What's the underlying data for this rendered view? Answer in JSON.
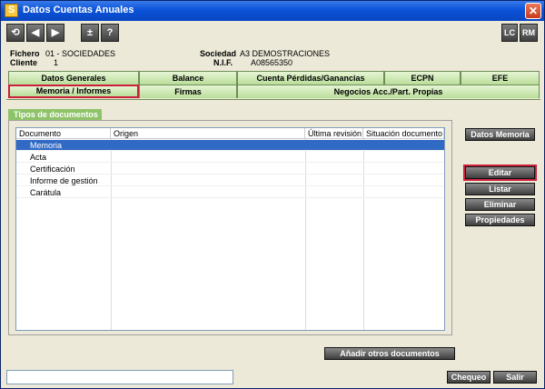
{
  "window": {
    "title": "Datos Cuentas Anuales",
    "app_icon": "S"
  },
  "toolbar": {
    "plus_minus": "±",
    "help": "?",
    "lc": "LC",
    "rm": "RM"
  },
  "info": {
    "fichero_label": "Fichero",
    "fichero_value": "01 - SOCIEDADES",
    "cliente_label": "Cliente",
    "cliente_value": "1",
    "sociedad_label": "Sociedad",
    "sociedad_value": "A3 DEMOSTRACIONES",
    "nif_label": "N.I.F.",
    "nif_value": "A08565350"
  },
  "tabs_row1": [
    "Datos Generales",
    "Balance",
    "Cuenta Pérdidas/Ganancias",
    "ECPN",
    "EFE"
  ],
  "tabs_row2": [
    "Memoria / Informes",
    "Firmas",
    "Negocios Acc./Part. Propias"
  ],
  "section": {
    "title": "Tipos de documentos"
  },
  "table": {
    "headers": [
      "Documento",
      "Origen",
      "Última revisión",
      "Situación documento"
    ],
    "rows": [
      "Memoria",
      "Acta",
      "Certificación",
      "Informe de gestión",
      "Carátula"
    ]
  },
  "buttons": {
    "datos_memoria": "Datos Memoria",
    "editar": "Editar",
    "listar": "Listar",
    "eliminar": "Eliminar",
    "propiedades": "Propiedades",
    "anadir": "Añadir otros documentos",
    "chequeo": "Chequeo",
    "salir": "Salir"
  }
}
